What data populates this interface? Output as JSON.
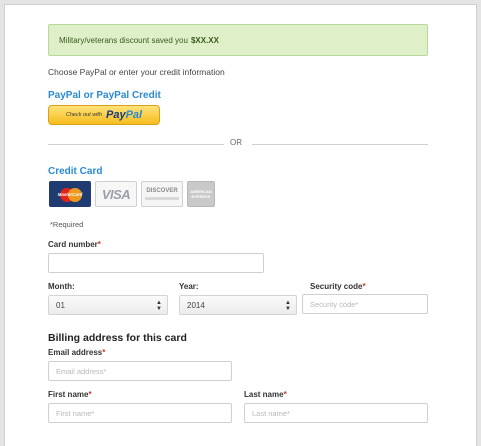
{
  "banner": {
    "text": "Military/veterans discount saved you",
    "amount": "$XX.XX"
  },
  "intro": "Choose PayPal or enter your credit information",
  "paypal_section": {
    "title": "PayPal or PayPal Credit",
    "button_small": "Check out with",
    "button_logo_a": "Pay",
    "button_logo_b": "Pal"
  },
  "divider": "OR",
  "credit_card": {
    "title": "Credit Card",
    "cards": [
      {
        "name": "MasterCard",
        "icon": "mastercard-icon"
      },
      {
        "name": "VISA",
        "icon": "visa-icon"
      },
      {
        "name": "DISCOVER",
        "icon": "discover-icon"
      },
      {
        "name": "AMERICAN EXPRESS",
        "icon": "amex-icon"
      }
    ]
  },
  "required_note": "*Required",
  "fields": {
    "card_number": {
      "label": "Card number",
      "value": ""
    },
    "month": {
      "label": "Month:",
      "value": "01"
    },
    "year": {
      "label": "Year:",
      "value": "2014"
    },
    "security_code": {
      "label": "Security code",
      "placeholder": "Security code*"
    }
  },
  "billing": {
    "heading": "Billing address for this card",
    "email": {
      "label": "Email address",
      "placeholder": "Email address*"
    },
    "first_name": {
      "label": "First name",
      "placeholder": "First name*"
    },
    "last_name": {
      "label": "Last name",
      "placeholder": "Last name*"
    }
  },
  "colors": {
    "link": "#2a8ad4",
    "banner_bg": "#dff0c8",
    "required_star": "#c0392b"
  }
}
